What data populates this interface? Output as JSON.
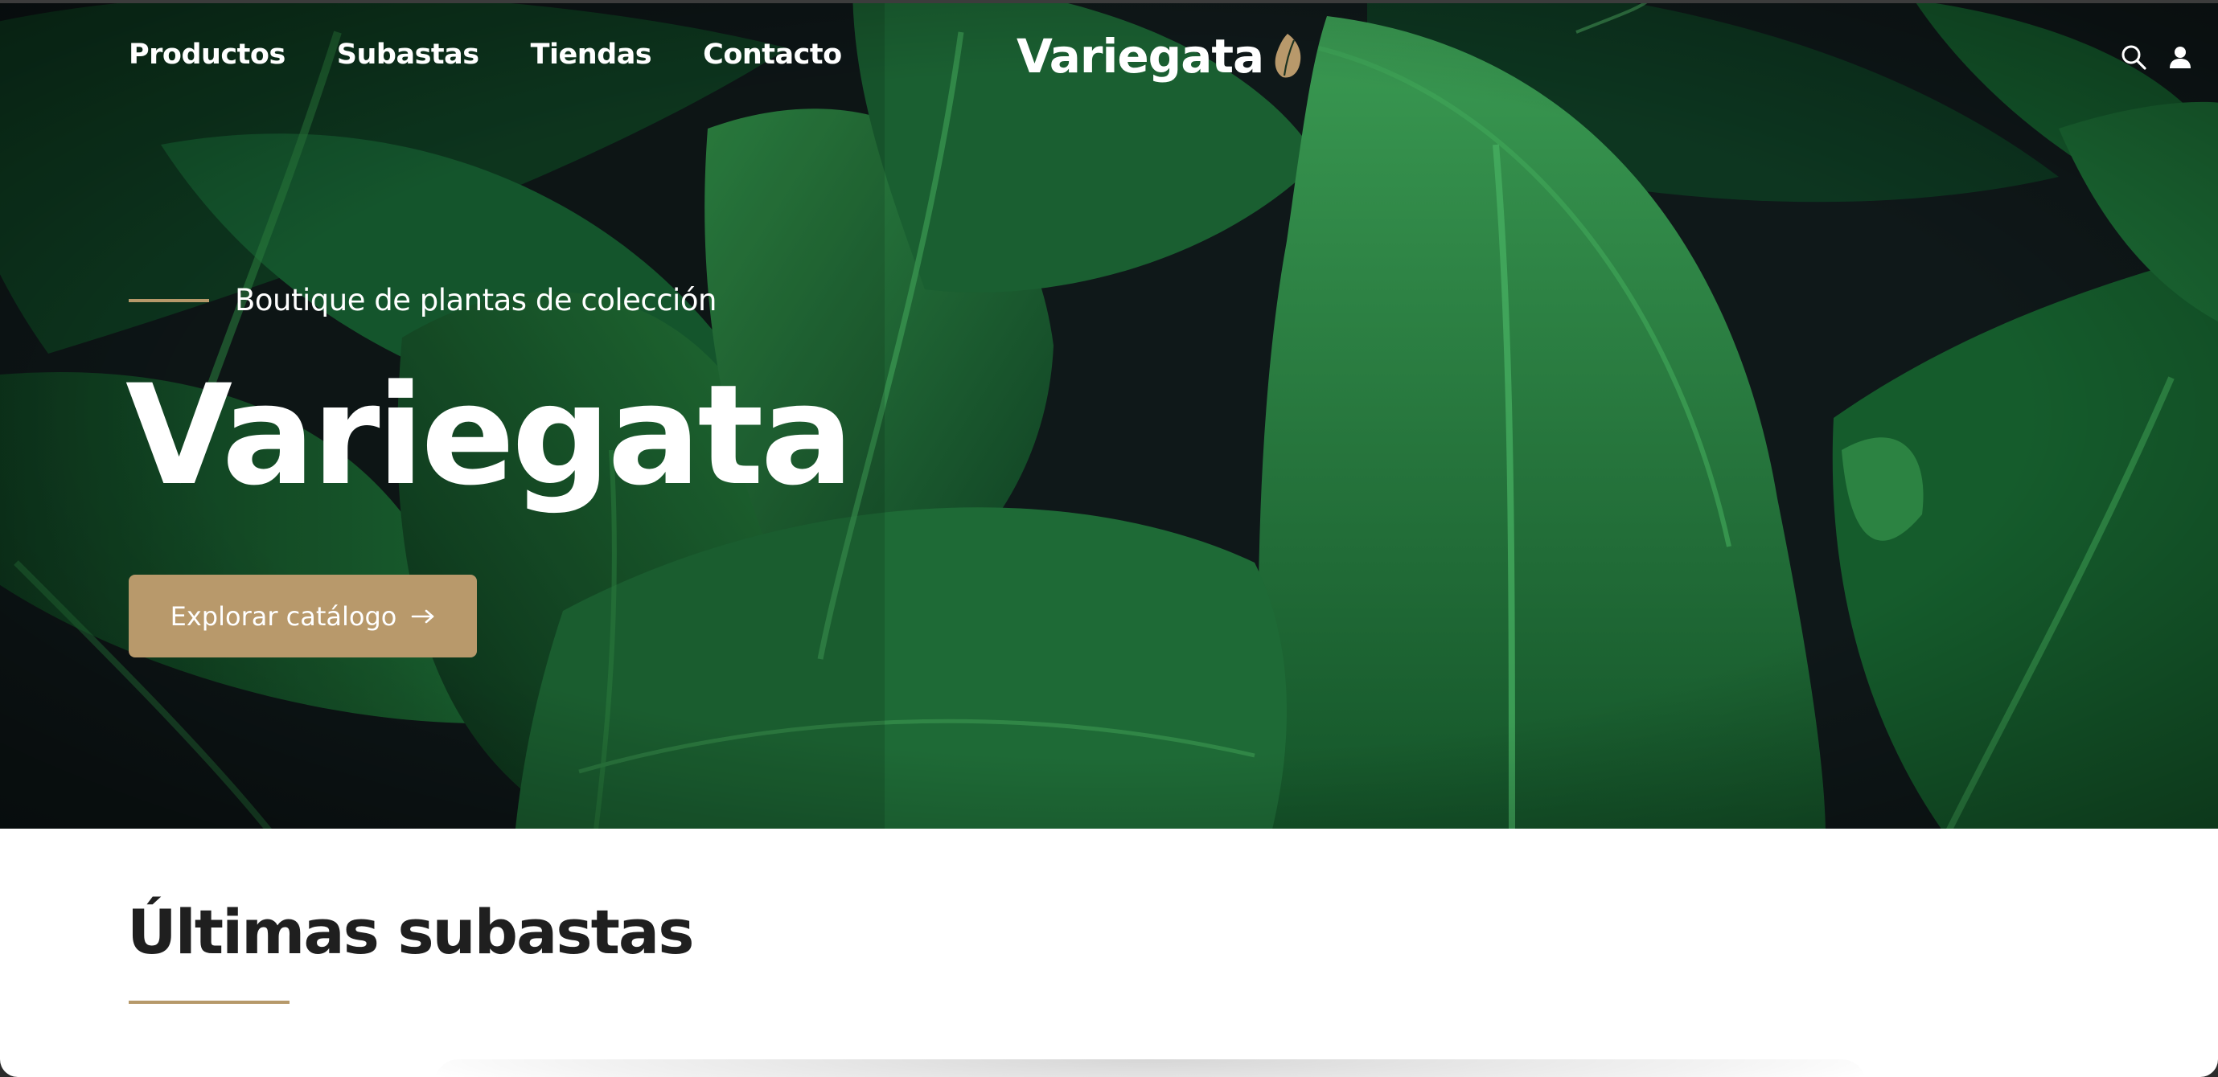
{
  "nav": {
    "links": [
      "Productos",
      "Subastas",
      "Tiendas",
      "Contacto"
    ],
    "brand": "Variegata",
    "icons": [
      "search-icon",
      "user-icon"
    ]
  },
  "hero": {
    "eyebrow": "Boutique de plantas de colección",
    "title": "Variegata",
    "cta_label": "Explorar catálogo",
    "cta_icon": "arrow-right-icon"
  },
  "section": {
    "title": "Últimas subastas"
  },
  "colors": {
    "accent": "#b8996b",
    "leaf_dark": "#0f3d22",
    "leaf_mid": "#1f6a35",
    "background_dark": "#101a1b",
    "heading": "#1f1f1f"
  }
}
